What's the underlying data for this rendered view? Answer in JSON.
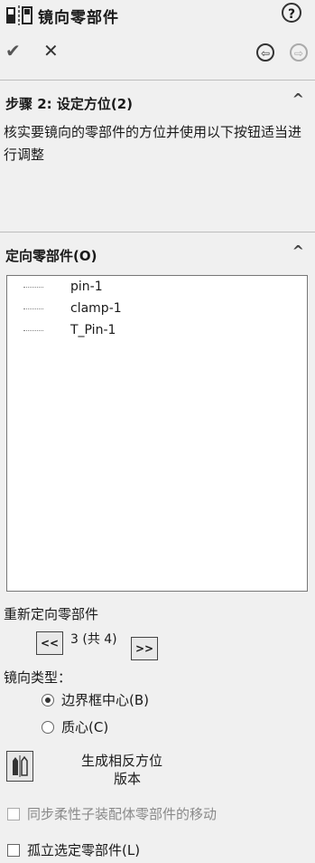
{
  "panel": {
    "title": "镜向零部件",
    "help_icon": "question-circle-icon",
    "help_glyph": "?",
    "ok_icon": "checkmark-icon",
    "ok_glyph": "✔",
    "cancel_icon": "close-icon",
    "cancel_glyph": "✕",
    "back_glyph": "⇦",
    "next_glyph": "⇨"
  },
  "step_section": {
    "title": "步骤 2: 设定方位(2)",
    "message": "核实要镜向的零部件的方位并使用以下按钮适当进行调整",
    "caret": "^"
  },
  "orient_section": {
    "title": "定向零部件(O)",
    "caret": "^",
    "items": [
      "pin-1",
      "clamp-1",
      "T_Pin-1"
    ]
  },
  "reorient": {
    "label": "重新定向零部件",
    "prev_label": "<<",
    "next_label": ">>",
    "counter": "3 (共 4)"
  },
  "mirror_type": {
    "label": "镜向类型：",
    "options": [
      "边界框中心(B)",
      "质心(C)"
    ],
    "selected_index": 0
  },
  "generate": {
    "label_line1": "生成相反方位",
    "label_line2": "版本"
  },
  "options": {
    "sync_flexible": "同步柔性子装配体零部件的移动",
    "isolate": "孤立选定零部件(L)"
  }
}
